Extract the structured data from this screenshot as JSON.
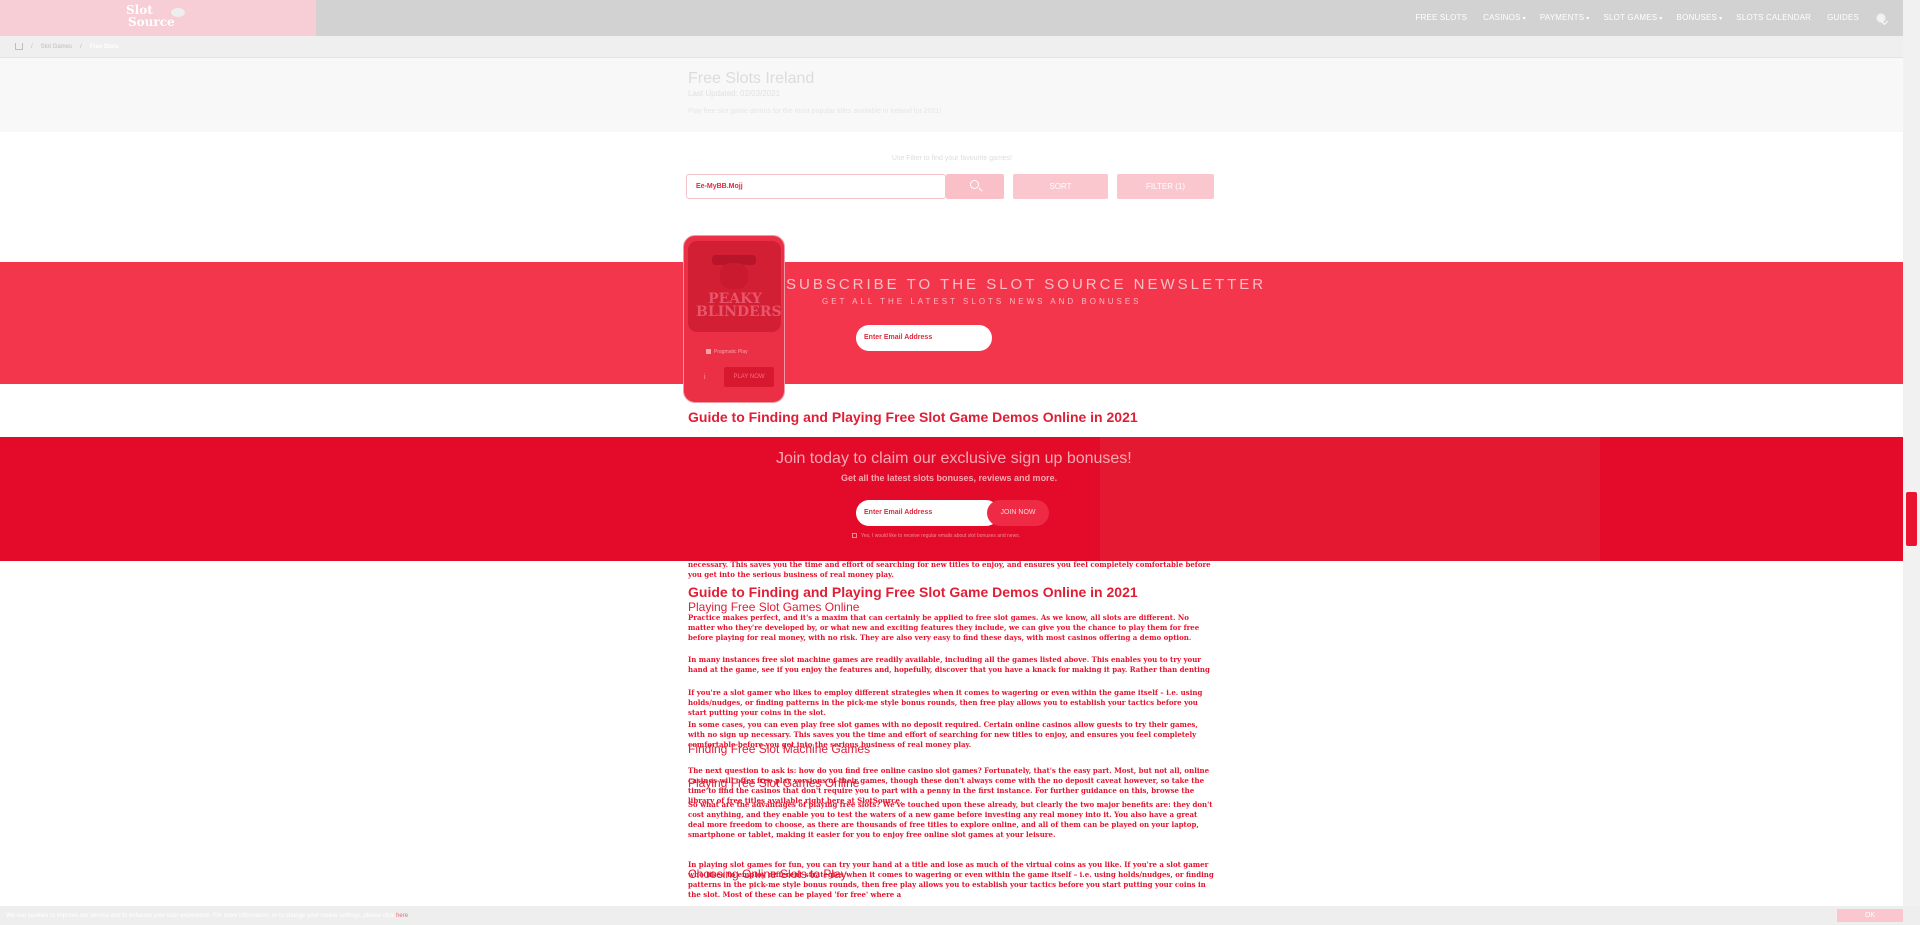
{
  "nav": {
    "logo_line1": "Slot",
    "logo_line2": "Source",
    "items": [
      {
        "label": "FREE SLOTS",
        "caret": ""
      },
      {
        "label": "CASINOS",
        "caret": "▾"
      },
      {
        "label": "PAYMENTS",
        "caret": "▾"
      },
      {
        "label": "SLOT GAMES",
        "caret": "▾"
      },
      {
        "label": "BONUSES",
        "caret": "▾"
      },
      {
        "label": "SLOTS CALENDAR",
        "caret": ""
      },
      {
        "label": "GUIDES",
        "caret": ""
      }
    ]
  },
  "breadcrumb": {
    "sep": "/",
    "items": [
      "Slot Games",
      "Free Slots"
    ]
  },
  "hero": {
    "title": "Free Slots Ireland",
    "updated": "Last Updated: 02/03/2021",
    "description": "Play free slot game demos for the most popular titles available in Ireland for 2021!"
  },
  "filter": {
    "hint": "Use Filter to find your favourite games!",
    "search_value": "Ee-MyBB.Mojj",
    "sort_label": "SORT",
    "filter_label": "FILTER (1)"
  },
  "newsletter": {
    "title": "SUBSCRIBE TO THE SLOT SOURCE NEWSLETTER",
    "subtitle": "GET ALL THE LATEST SLOTS NEWS AND BONUSES",
    "input_placeholder": "Enter Email Address"
  },
  "card": {
    "title": "PEAKY BLINDERS",
    "provider": "Pragmatic Play",
    "info": "i",
    "play_label": "PLAY NOW"
  },
  "headings": {
    "guide": "Guide to Finding and Playing Free Slot Game Demos Online in 2021",
    "playing": "Playing Free Slot Games Online",
    "finding": "Finding Free Slot Machine Games",
    "choosing": "Choosing Online Slots to Play"
  },
  "signup": {
    "title": "Join today to claim our exclusive sign up bonuses!",
    "subtitle": "Get all the latest slots bonuses, reviews and more.",
    "input_placeholder": "Enter Email Address",
    "join_label": "JOIN NOW",
    "consent": "Yes, I would like to receive regular emails about slot bonuses and news."
  },
  "paragraphs": {
    "p1": "necessary. This saves you the time and effort of searching for new titles to enjoy, and ensures you feel completely comfortable before you get into the serious business of real money play.",
    "p2": "Practice makes perfect, and it's a maxim that can certainly be applied to free slot games. As we know, all slots are different. No matter who they're developed by, or what new and exciting features they include, we can give you the chance to play them for free before playing for real money, with no risk. They are also very easy to find these days, with most casinos offering a demo option.",
    "p3": "In many instances free slot machine games are readily available, including all the games listed above. This enables you to try your hand at the game, see if you enjoy the features and, hopefully, discover that you have a knack for making it pay. Rather than denting your bankroll trying a variety of different slots, you can sample all of the games for free.",
    "p4": "If you're a slot gamer who likes to employ different strategies when it comes to wagering or even within the game itself – i.e. using holds/nudges, or finding patterns in the pick-me style bonus rounds, then free play allows you to establish your tactics before you start putting your coins in the slot.",
    "p5": "In some cases, you can even play free slot games with no deposit required. Certain online casinos allow guests to try their games, with no sign up necessary. This saves you the time and effort of searching for new titles to enjoy, and ensures you feel completely comfortable before you get into the serious business of real money play.",
    "p6": "The next question to ask is: how do you find free online casino slot games? Fortunately, that's the easy part. Most, but not all, online casinos will offer free play versions of their games, though these don't always come with the no deposit caveat however, so take the time to find the casinos that don't require you to part with a penny in the first instance. For further guidance on this, browse the library of free titles available right here at SlotSource.",
    "p7": "So what are the advantages of playing free slots? We've touched upon these already, but clearly the two major benefits are: they don't cost anything, and they enable you to test the waters of a new game before investing any real money into it. You also have a great deal more freedom to choose, as there are thousands of free titles to explore online, and all of them can be played on your laptop, smartphone or tablet, making it easier for you to enjoy free online slot games at your leisure.",
    "p8": "In playing slot games for fun, you can try your hand at a title and lose as much of the virtual coins as you like. If you're a slot gamer who likes to employ different strategies when it comes to wagering or even within the game itself – i.e. using holds/nudges, or finding patterns in the pick-me style bonus rounds, then free play allows you to establish your tactics before you start putting your coins in the slot. Most of these can be played 'for free' where a"
  },
  "cookie": {
    "text": "We use cookies to improve our service and to enhance your user experience. For more information, or to change your cookie settings, please click",
    "link": "here",
    "ok": "OK"
  },
  "colors": {
    "accent": "#e01e36",
    "band": "#f4364c",
    "signup": "#e30a2a",
    "nav": "#d2d2d2"
  }
}
